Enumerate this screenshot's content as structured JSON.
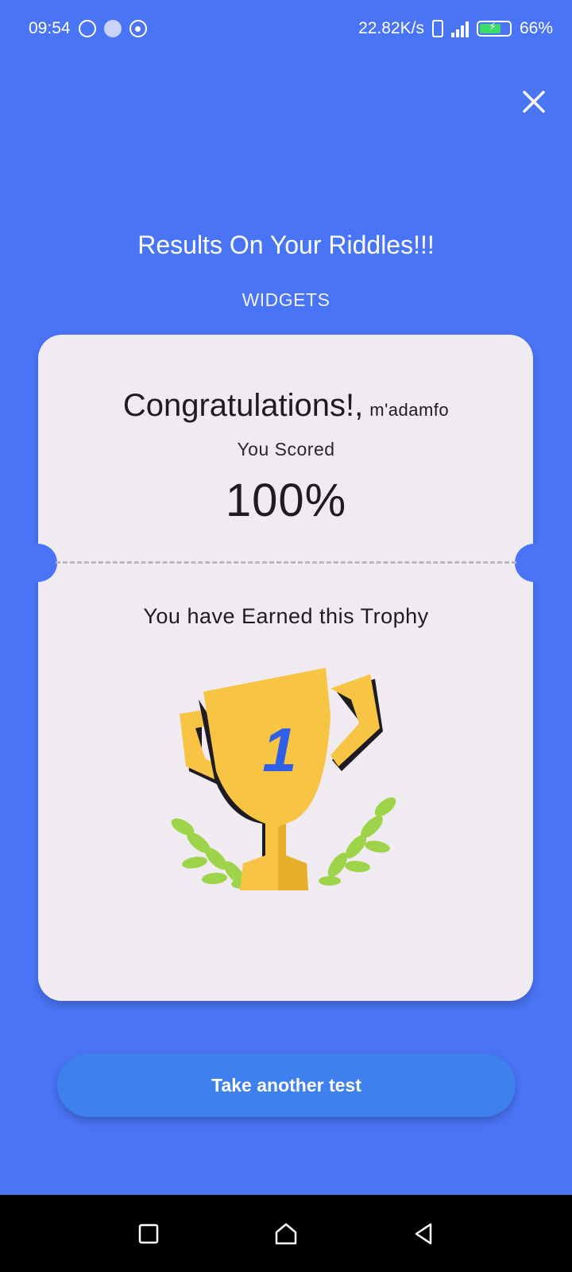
{
  "status_bar": {
    "time": "09:54",
    "network_speed": "22.82K/s",
    "battery": "66%"
  },
  "header": {
    "title": "Results On Your Riddles!!!",
    "category": "WIDGETS"
  },
  "result_card": {
    "greeting": "Congratulations!,",
    "username": "m'adamfo",
    "score_label": "You Scored",
    "score": "100%",
    "trophy_text": "You have Earned this Trophy",
    "trophy_rank": "1"
  },
  "actions": {
    "take_another_test": "Take another test"
  },
  "colors": {
    "background": "#4a74f6",
    "card": "#efebf1",
    "button": "#3d80ee",
    "trophy_gold": "#f8c443",
    "laurel_green": "#9ed44a"
  },
  "icons": {
    "close": "close-icon",
    "nav_recents": "recents-icon",
    "nav_home": "home-icon",
    "nav_back": "back-icon"
  }
}
